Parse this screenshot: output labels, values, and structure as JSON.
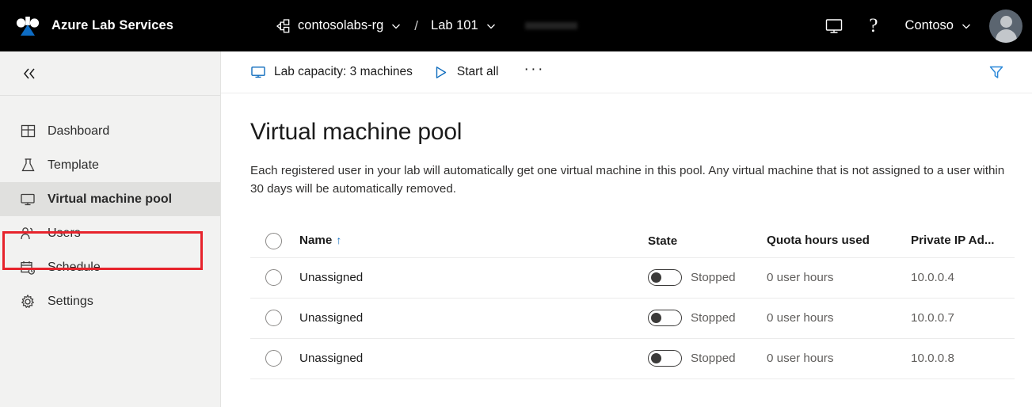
{
  "topbar": {
    "logo_icon": "azure-lab-services-logo",
    "brand": "Azure Lab Services",
    "breadcrumb": {
      "resource_group_icon": "resource-group-icon",
      "resource_group": "contosolabs-rg",
      "separator": "/",
      "lab": "Lab 101",
      "chevron_icon": "chevron-down-icon"
    },
    "redacted_icon": "redacted-bar",
    "monitor_icon": "monitor-icon",
    "help_label": "?",
    "help_icon": "question-mark-icon",
    "tenant": "Contoso",
    "tenant_chevron_icon": "chevron-down-icon",
    "avatar_icon": "user-avatar"
  },
  "sidebar": {
    "collapse_icon": "double-chevron-left-icon",
    "items": [
      {
        "label": "Dashboard",
        "icon": "dashboard-icon",
        "selected": false
      },
      {
        "label": "Template",
        "icon": "flask-icon",
        "selected": false
      },
      {
        "label": "Virtual machine pool",
        "icon": "monitor-icon",
        "selected": true
      },
      {
        "label": "Users",
        "icon": "people-icon",
        "selected": false
      },
      {
        "label": "Schedule",
        "icon": "calendar-clock-icon",
        "selected": false
      },
      {
        "label": "Settings",
        "icon": "gear-icon",
        "selected": false
      }
    ],
    "highlight_color": "#e7232c"
  },
  "commandbar": {
    "capacity_icon": "monitor-icon",
    "capacity_label": "Lab capacity: 3 machines",
    "start_all_icon": "play-triangle-icon",
    "start_all_label": "Start all",
    "more_label": "···",
    "more_icon": "ellipsis-icon",
    "filter_icon": "filter-funnel-icon",
    "accent_color": "#0f6cbd"
  },
  "page": {
    "title": "Virtual machine pool",
    "description": "Each registered user in your lab will automatically get one virtual machine in this pool. Any virtual machine that is not assigned to a user within 30 days will be automatically removed."
  },
  "table": {
    "select_all_icon": "radio-unchecked-icon",
    "columns": [
      {
        "label": "Name",
        "sort": "↑"
      },
      {
        "label": "State"
      },
      {
        "label": "Quota hours used"
      },
      {
        "label": "Private IP Ad..."
      }
    ],
    "rows": [
      {
        "name": "Unassigned",
        "state": "Stopped",
        "toggle": "off",
        "quota": "0 user hours",
        "ip": "10.0.0.4"
      },
      {
        "name": "Unassigned",
        "state": "Stopped",
        "toggle": "off",
        "quota": "0 user hours",
        "ip": "10.0.0.7"
      },
      {
        "name": "Unassigned",
        "state": "Stopped",
        "toggle": "off",
        "quota": "0 user hours",
        "ip": "10.0.0.8"
      }
    ]
  }
}
